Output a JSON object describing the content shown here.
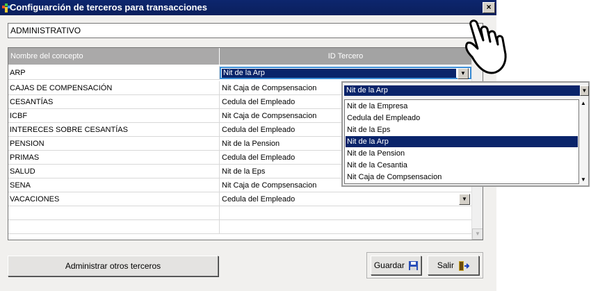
{
  "window": {
    "title": "Configuarción de terceros para transacciones",
    "close_label": "×"
  },
  "department": "ADMINISTRATIVO",
  "grid": {
    "headers": [
      "Nombre del concepto",
      "ID Tercero"
    ],
    "rows": [
      {
        "concept": "ARP",
        "tercero": "Nit de la Arp"
      },
      {
        "concept": "CAJAS DE COMPENSACIÓN",
        "tercero": "Nit Caja de Compsensacion"
      },
      {
        "concept": "CESANTÍAS",
        "tercero": "Cedula del Empleado"
      },
      {
        "concept": "ICBF",
        "tercero": "Nit Caja de Compsensacion"
      },
      {
        "concept": "INTERECES SOBRE CESANTÍAS",
        "tercero": "Cedula del Empleado"
      },
      {
        "concept": "PENSION",
        "tercero": "Nit de la Pension"
      },
      {
        "concept": "PRIMAS",
        "tercero": "Cedula del Empleado"
      },
      {
        "concept": "SALUD",
        "tercero": "Nit de la Eps"
      },
      {
        "concept": "SENA",
        "tercero": "Nit Caja de Compsensacion"
      },
      {
        "concept": "VACACIONES",
        "tercero": "Cedula del Empleado"
      }
    ]
  },
  "dropdown": {
    "selected": "Nit de la Arp",
    "options": [
      "Nit de la Empresa",
      "Cedula del Empleado",
      "Nit de la Eps",
      "Nit de la Arp",
      "Nit de la Pension",
      "Nit de la Cesantia",
      "Nit Caja de Compsensacion"
    ],
    "highlighted_index": 3
  },
  "buttons": {
    "admin_label": "Administrar otros terceros",
    "save_label": "Guardar",
    "exit_label": "Salir"
  },
  "icons": {
    "save": "floppy-disk-icon",
    "exit": "exit-door-icon",
    "cursor": "hand-pointer-icon"
  },
  "colors": {
    "title_bar": "#0d266e",
    "selection": "#0a246a",
    "focus_border": "#3c8fd8",
    "header": "#aaa9a9"
  }
}
